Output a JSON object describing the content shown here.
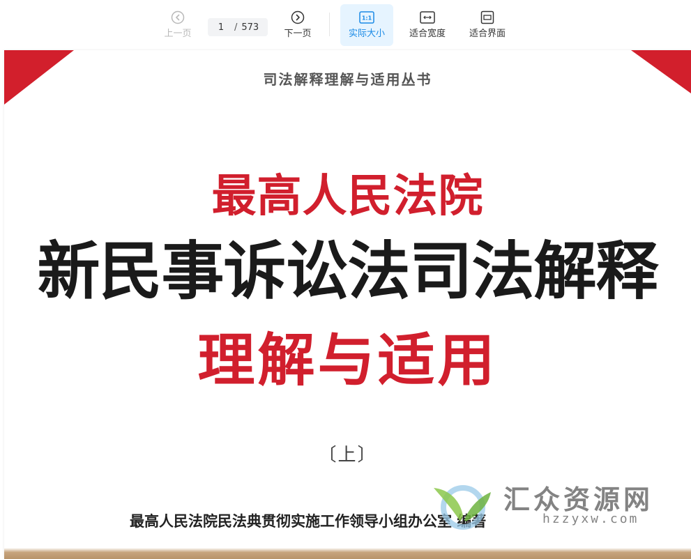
{
  "toolbar": {
    "prev_label": "上一页",
    "next_label": "下一页",
    "current_page": "1",
    "page_separator": "/",
    "total_pages": "573",
    "actual_size_label": "实际大小",
    "actual_size_icon_text": "1:1",
    "fit_width_label": "适合宽度",
    "fit_screen_label": "适合界面",
    "accent_color": "#1a8ae6"
  },
  "icons": {
    "prev": "chevron-left-circle-icon",
    "next": "chevron-right-circle-icon",
    "actual_size": "actual-size-icon",
    "fit_width": "fit-width-icon",
    "fit_screen": "fit-screen-icon"
  },
  "document": {
    "series_title": "司法解释理解与适用丛书",
    "title_line1": "最高人民法院",
    "title_line2": "新民事诉讼法司法解释",
    "title_line3": "理解与适用",
    "volume": "〔上〕",
    "author": "最高人民法院民法典贯彻实施工作领导小组办公室  编著",
    "accent_red": "#d11f2d"
  },
  "watermark": {
    "name": "汇众资源网",
    "url": "hzzyxw.com"
  }
}
